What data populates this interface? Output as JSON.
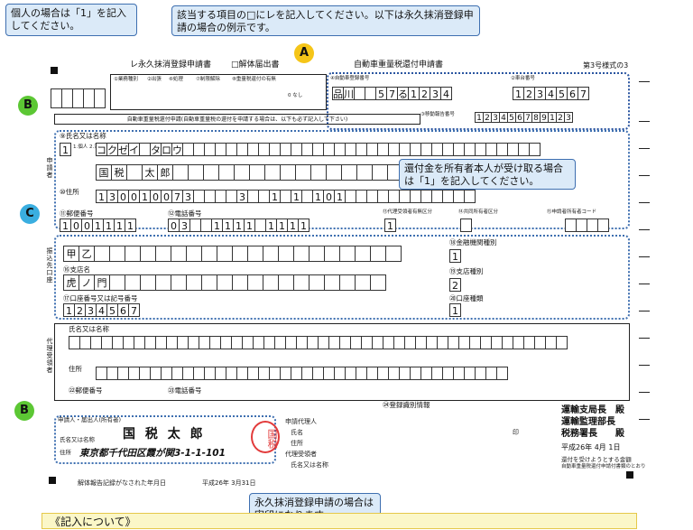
{
  "callouts": {
    "individual": "個人の場合は「1」を記入してください。",
    "checkmark": "該当する項目の□にレを記入してください。以下は永久抹消登録申請の場合の例示です。",
    "refund_owner": "還付金を所有者本人が受け取る場合は「1」を記入してください。",
    "seal": "永久抹消登録申請の場合は実印になります。"
  },
  "markers": {
    "a": "A",
    "b1": "B",
    "c": "C",
    "b2": "B"
  },
  "header": {
    "check_permanent": "レ永久抹消登録申請書",
    "check_dismantle": "□解体届出書",
    "title": "自動車重量税還付申請書",
    "form_no": "第3号様式の3",
    "reg_no_label": "④自動車登録番号",
    "reg_no_chars": [
      "品",
      "川",
      "",
      "",
      "5",
      "7",
      "る",
      "1",
      "2",
      "3",
      "4"
    ],
    "car_no_label": "②車台番号",
    "car_no_chars": [
      "1",
      "2",
      "3",
      "4",
      "5",
      "6",
      "7"
    ],
    "move_report_label": "③移動報告番号",
    "move_report_chars": [
      "1",
      "2",
      "3",
      "4",
      "5",
      "6",
      "7",
      "8",
      "9",
      "1",
      "2",
      "3"
    ],
    "business_type": "①業務種別",
    "office": "②出張",
    "handling": "⑥処理",
    "restriction": "⑦制限解除",
    "refund_presence": "⑧重量税還付の有無",
    "opt_none": "0 なし"
  },
  "applicant": {
    "section_title": "自動車重量税還付申請(自動車重量税の還付を申請する場合は、以下も必ず記入して下さい)",
    "name_label": "⑨氏名又は名称",
    "type_value": "1",
    "type_note": "1.個人 2.法人等",
    "kana": [
      "コ",
      "ク",
      "ゼ",
      "イ",
      "",
      "タ",
      "ロ",
      "ウ"
    ],
    "kanji_name": [
      "国",
      "税",
      "",
      "太",
      "郎"
    ],
    "address_label": "⑩住所",
    "address_code": [
      "1",
      "3",
      "0",
      "0",
      "1",
      "0",
      "0",
      "7",
      "3"
    ],
    "address_parts": [
      "3",
      "1",
      "1",
      "1",
      "0",
      "1"
    ],
    "postal_label": "⑪郵便番号",
    "postal": [
      "1",
      "0",
      "0",
      "1",
      "1",
      "1",
      "1"
    ],
    "phone_label": "⑫電話番号",
    "phone": [
      "0",
      "3",
      "1",
      "1",
      "1",
      "1",
      "1",
      "1",
      "1",
      "1"
    ],
    "agent_flag_label": "⑬代理受領者有無区分",
    "agent_flag": "1",
    "joint_label": "⑭共同所有者区分",
    "joint_code_label": "⑮申請者所有者コード",
    "section_vertical": "申請者"
  },
  "bank": {
    "section_vertical": "振込先口座",
    "bank_name": [
      "甲",
      "乙"
    ],
    "branch_label": "⑯支店名",
    "branch_name": [
      "虎",
      "ノ",
      "門"
    ],
    "account_label": "⑰口座番号又は記号番号",
    "account": [
      "1",
      "2",
      "3",
      "4",
      "5",
      "6",
      "7"
    ],
    "inst_type_label": "⑱金融機関種別",
    "inst_type": "1",
    "branch_type_label": "⑲支店種別",
    "branch_type": "2",
    "account_type_label": "⑳口座種類",
    "account_type": "1"
  },
  "agent": {
    "section_vertical": "代理受領者",
    "name_label": "氏名又は名称",
    "address_label": "住所",
    "postal_label": "㉒郵便番号",
    "phone_label": "㉓電話番号",
    "reg_info_label": "㉔登録識別情報"
  },
  "footer": {
    "applicant_label": "申請人・届出人(所有者)",
    "name_label": "氏名又は名称",
    "name_value": "国 税 太 郎",
    "address_label": "住所",
    "address_value": "東京都千代田区霞が関3-1-1-101",
    "seal_text": "国税",
    "rep_label": "申請代理人",
    "rep_name": "氏名",
    "rep_address": "住所",
    "agent_label": "代理受領者",
    "agent_name": "氏名又は名称",
    "agent_address": "住所",
    "stamp_mark": "印",
    "dismantle_date_label": "解体報告記録がなされた年月日",
    "dismantle_date": "平成26年 3月31日",
    "office1": "運輸支局長　殿",
    "office2": "運輸監理部長",
    "office3": "税務署長　　殿",
    "date": "平成26年 4月 1日",
    "refund_label": "還付を受けようとする金額",
    "refund_note": "自動車重量税還付申請付書類のとおり"
  },
  "note_bar": "《記入について》",
  "colors": {
    "callout_bg": "#dbeaf8",
    "callout_border": "#3e6fb0",
    "marker_a": "#f5c518",
    "marker_b": "#5cc734",
    "marker_c": "#3aaee0",
    "seal_red": "#e23b3b"
  }
}
